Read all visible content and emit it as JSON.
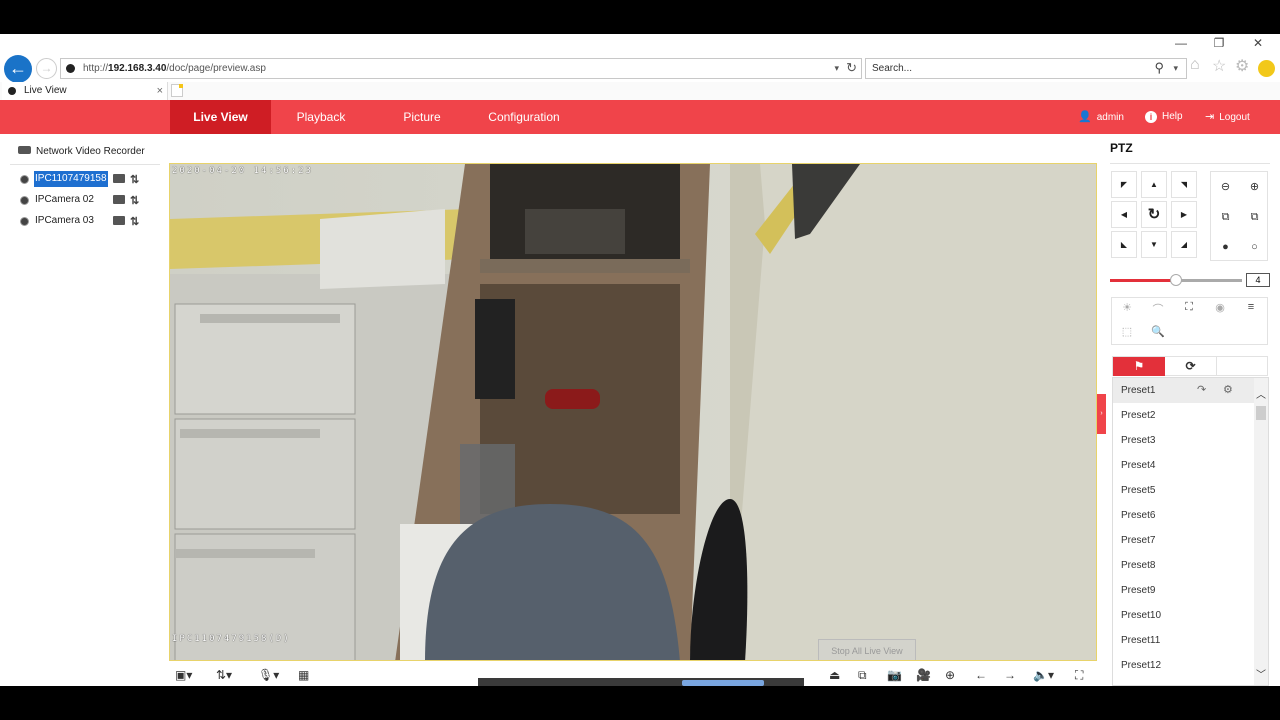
{
  "browser": {
    "window_controls": {
      "minimize": "—",
      "restore": "❐",
      "close": "✕"
    },
    "url_prefix": "http://",
    "url_host": "192.168.3.40",
    "url_path": "/doc/page/preview.asp",
    "search_placeholder": "Search...",
    "tab_title": "Live View",
    "tab_close": "×"
  },
  "nav": {
    "items": [
      {
        "label": "Live View",
        "active": true
      },
      {
        "label": "Playback"
      },
      {
        "label": "Picture"
      },
      {
        "label": "Configuration"
      }
    ],
    "user": "admin",
    "help": "Help",
    "logout": "Logout"
  },
  "tree": {
    "root": "Network Video Recorder",
    "cameras": [
      {
        "name": "IPC1107479158",
        "selected": true
      },
      {
        "name": "IPCamera 02"
      },
      {
        "name": "IPCamera 03"
      }
    ]
  },
  "video": {
    "timestamp": "2020-04-20 14:56:23",
    "channel_osd": "IPC1107479158(D)",
    "stop_all_label": "Stop All Live View"
  },
  "ptz": {
    "title": "PTZ",
    "speed": "4",
    "speed_fraction": 0.5,
    "presets": [
      "Preset1",
      "Preset2",
      "Preset3",
      "Preset4",
      "Preset5",
      "Preset6",
      "Preset7",
      "Preset8",
      "Preset9",
      "Preset10",
      "Preset11",
      "Preset12"
    ]
  },
  "colors": {
    "brand": "#f0444a",
    "active_nav": "#cf1d24",
    "selection": "#1e6fd0"
  }
}
